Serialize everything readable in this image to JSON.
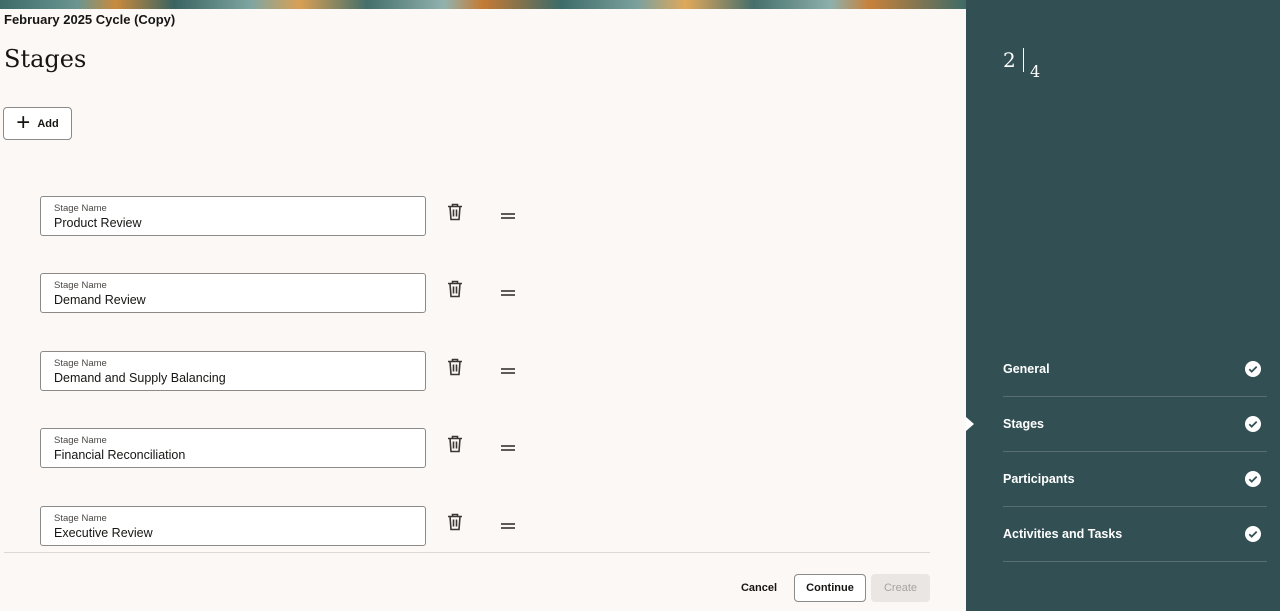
{
  "header": {
    "cycle_title": "February 2025 Cycle (Copy)",
    "page_title": "Stages"
  },
  "toolbar": {
    "add_label": "Add"
  },
  "stages": [
    {
      "label": "Stage Name",
      "value": "Product Review"
    },
    {
      "label": "Stage Name",
      "value": "Demand Review"
    },
    {
      "label": "Stage Name",
      "value": "Demand and Supply Balancing"
    },
    {
      "label": "Stage Name",
      "value": "Financial Reconciliation"
    },
    {
      "label": "Stage Name",
      "value": "Executive Review"
    }
  ],
  "footer": {
    "cancel_label": "Cancel",
    "continue_label": "Continue",
    "create_label": "Create"
  },
  "sidebar": {
    "step_current": "2",
    "step_total": "4",
    "items": [
      {
        "label": "General",
        "icon": "check-circle-icon"
      },
      {
        "label": "Stages",
        "icon": "check-circle-icon"
      },
      {
        "label": "Participants",
        "icon": "check-circle-icon"
      },
      {
        "label": "Activities and Tasks",
        "icon": "check-circle-icon"
      }
    ]
  },
  "colors": {
    "sidebar_bg": "#325054",
    "page_bg": "#fcf8f6",
    "border": "#8c8986"
  }
}
